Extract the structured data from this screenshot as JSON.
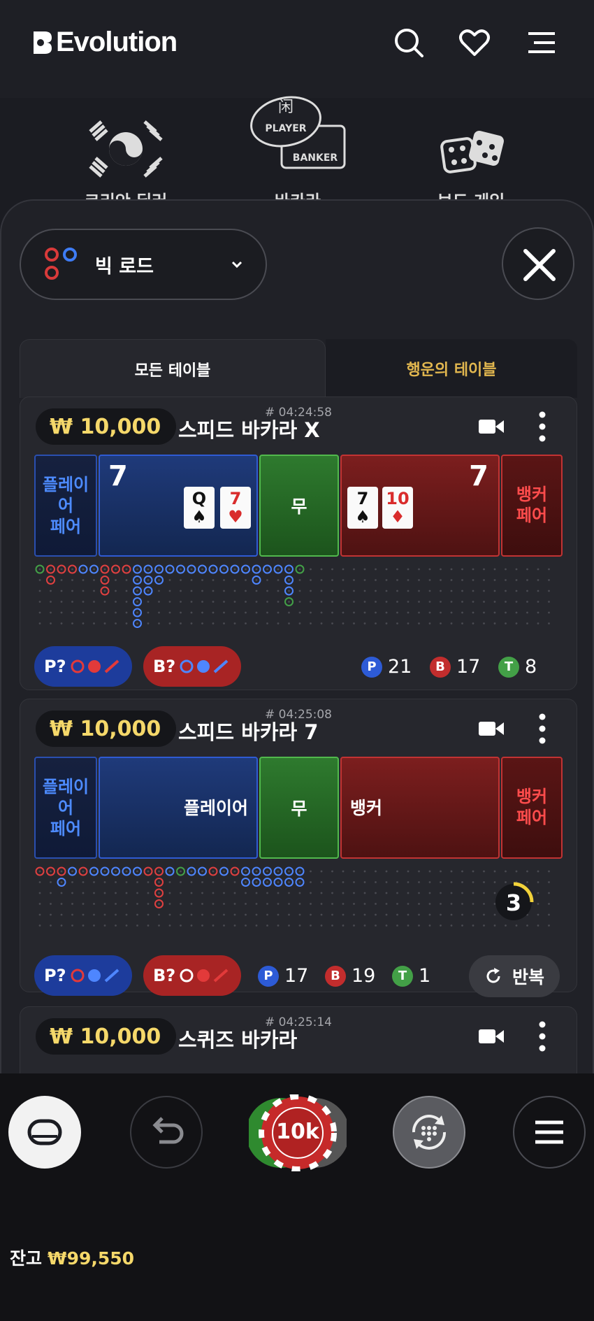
{
  "brand": {
    "name": "Evolution"
  },
  "header": {
    "icons": [
      "search-icon",
      "heart-icon",
      "menu-icon"
    ]
  },
  "categories": [
    {
      "label": "코리안 딜러",
      "icon": "korean-flag-icon"
    },
    {
      "label": "바카라",
      "icon": "baccarat-player-banker-icon",
      "icon_text_top": "PLAYER",
      "icon_text_bottom": "BANKER"
    },
    {
      "label": "보드 게임",
      "icon": "dice-icon"
    }
  ],
  "road_selector": {
    "label": "빅 로드"
  },
  "tabs": {
    "all": "모든 테이블",
    "lucky": "행운의 테이블"
  },
  "tables": [
    {
      "timestamp": "# 04:24:58",
      "bet": "₩ 10,000",
      "name": "스피드 바카라 X",
      "player_pair": "플레이어페어",
      "player_pair_lines": [
        "플레이",
        "어",
        "페어"
      ],
      "player_score": "7",
      "player_cards": [
        {
          "rank": "Q",
          "suit": "♠",
          "color": "black"
        },
        {
          "rank": "7",
          "suit": "♥",
          "color": "red"
        }
      ],
      "tie": "무",
      "banker_score": "7",
      "banker_cards": [
        {
          "rank": "7",
          "suit": "♠",
          "color": "black"
        },
        {
          "rank": "10",
          "suit": "♦",
          "color": "red"
        }
      ],
      "banker_pair_lines": [
        "뱅커",
        "페어"
      ],
      "pred_p": "P?",
      "pred_b": "B?",
      "stats": {
        "p": "21",
        "b": "17",
        "t": "8"
      },
      "stat_letters": {
        "p": "P",
        "b": "B",
        "t": "T"
      }
    },
    {
      "timestamp": "# 04:25:08",
      "bet": "₩ 10,000",
      "name": "스피드 바카라 7",
      "player_pair_lines": [
        "플레이",
        "어",
        "페어"
      ],
      "player_label": "플레이어",
      "tie": "무",
      "banker_label": "뱅커",
      "banker_pair_lines": [
        "뱅커",
        "페어"
      ],
      "countdown": "3",
      "pred_p": "P?",
      "pred_b": "B?",
      "stats": {
        "p": "17",
        "b": "19",
        "t": "1"
      },
      "stat_letters": {
        "p": "P",
        "b": "B",
        "t": "T"
      },
      "repeat": "반복"
    },
    {
      "timestamp": "# 04:25:14",
      "bet": "₩ 10,000",
      "name": "스퀴즈 바카라"
    }
  ],
  "controls": {
    "chip_value": "10k",
    "balance_label": "잔고",
    "balance_value": "₩99,550"
  },
  "colors": {
    "accent_gold": "#f5d86a",
    "player_blue": "#2f5bd4",
    "banker_red": "#c23333",
    "tie_green": "#51b94d"
  }
}
